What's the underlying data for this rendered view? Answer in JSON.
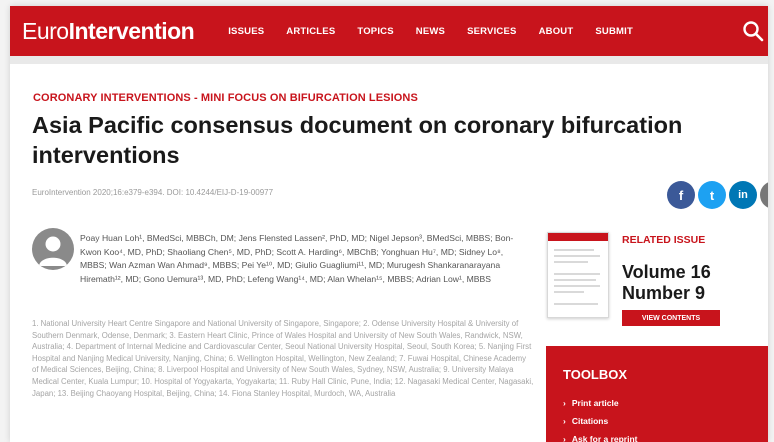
{
  "header": {
    "logo_light": "Euro",
    "logo_bold": "Intervention",
    "nav": [
      "ISSUES",
      "ARTICLES",
      "TOPICS",
      "NEWS",
      "SERVICES",
      "ABOUT",
      "SUBMIT"
    ],
    "icons": {
      "search": "search-icon"
    }
  },
  "article": {
    "category": "CORONARY INTERVENTIONS - MINI FOCUS ON BIFURCATION LESIONS",
    "title": "Asia Pacific consensus document on coronary bifurcation interventions",
    "citation": "EuroIntervention 2020;16:e379-e394. DOI: 10.4244/EIJ-D-19-00977",
    "share": [
      {
        "name": "facebook-share-button",
        "glyph": "f",
        "color": "#3b5998"
      },
      {
        "name": "twitter-share-button",
        "glyph": "t",
        "color": "#1da1f2"
      },
      {
        "name": "linkedin-share-button",
        "glyph": "in",
        "color": "#0077b5"
      },
      {
        "name": "email-share-button",
        "glyph": "@",
        "color": "#777777"
      }
    ],
    "authors": "Poay Huan Loh¹, BMedSci, MBBCh, DM; Jens Flensted Lassen², PhD, MD; Nigel Jepson³, BMedSci, MBBS; Bon-Kwon Koo⁴, MD, PhD; Shaoliang Chen⁵, MD, PhD; Scott A. Harding⁶, MBChB; Yonghuan Hu⁷, MD; Sidney Lo⁸, MBBS; Wan Azman Wan Ahmad⁹, MBBS; Pei Ye¹⁰, MD; Giulio Guagliumi¹¹, MD; Murugesh Shankaranarayana Hiremath¹², MD; Gono Uemura¹³, MD, PhD; Lefeng Wang¹⁴, MD; Alan Whelan¹⁵, MBBS; Adrian Low¹, MBBS",
    "affiliations": "1. National University Heart Centre Singapore and National University of Singapore, Singapore; 2. Odense University Hospital & University of Southern Denmark, Odense, Denmark; 3. Eastern Heart Clinic, Prince of Wales Hospital and University of New South Wales, Randwick, NSW, Australia; 4. Department of Internal Medicine and Cardiovascular Center, Seoul National University Hospital, Seoul, South Korea; 5. Nanjing First Hospital and Nanjing Medical University, Nanjing, China; 6. Wellington Hospital, Wellington, New Zealand; 7. Fuwai Hospital, Chinese Academy of Medical Sciences, Beijing, China; 8. Liverpool Hospital and University of New South Wales, Sydney, NSW, Australia; 9. University Malaya Medical Center, Kuala Lumpur; 10. Hospital of Yogyakarta, Yogyakarta; 11. Ruby Hall Clinic, Pune, India; 12. Nagasaki Medical Center, Nagasaki, Japan; 13. Beijing Chaoyang Hospital, Beijing, China; 14. Fiona Stanley Hospital, Murdoch, WA, Australia"
  },
  "related": {
    "label": "RELATED ISSUE",
    "volume": "Volume 16 Number 9",
    "button": "VIEW CONTENTS"
  },
  "toolbox": {
    "title": "TOOLBOX",
    "items": [
      "Print article",
      "Citations",
      "Ask for a reprint"
    ]
  },
  "colors": {
    "brand_red": "#c8141c"
  }
}
